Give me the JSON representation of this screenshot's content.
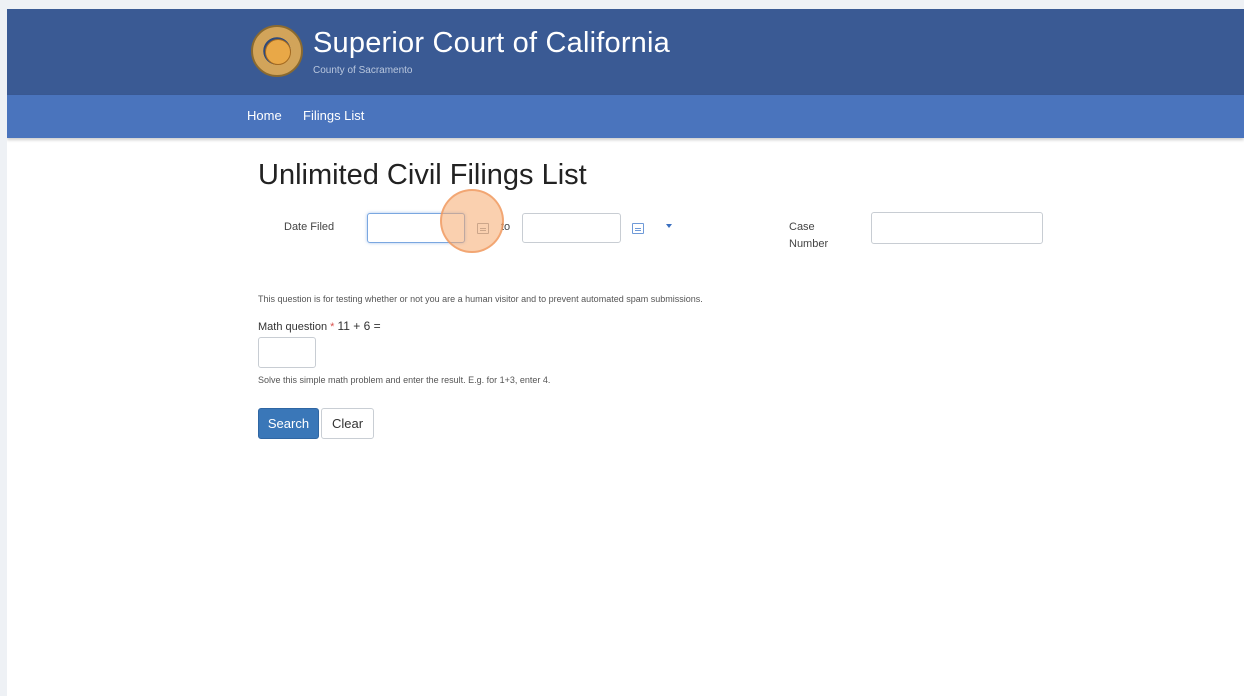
{
  "header": {
    "title": "Superior Court of California",
    "subtitle": "County of Sacramento",
    "seal_icon": "court-seal-icon"
  },
  "nav": {
    "items": [
      {
        "label": "Home"
      },
      {
        "label": "Filings List"
      }
    ]
  },
  "main": {
    "page_title": "Unlimited Civil Filings List",
    "date_filed_label": "Date Filed",
    "date_from_value": "",
    "date_to_label": "to",
    "date_to_value": "",
    "case_number_label_line1": "Case",
    "case_number_label_line2": "Number",
    "case_number_value": "",
    "captcha_description": "This question is for testing whether or not you are a human visitor and to prevent automated spam submissions.",
    "math_question_label": "Math question",
    "math_required_mark": "*",
    "math_question_text": "11 + 6 =",
    "math_answer_value": "",
    "math_help": "Solve this simple math problem and enter the result. E.g. for 1+3, enter 4.",
    "search_button": "Search",
    "clear_button": "Clear"
  },
  "colors": {
    "header_bg": "#3a5a94",
    "nav_bg": "#4a74bd",
    "primary_button": "#3a77b8",
    "click_marker": "#f5aa6e"
  }
}
